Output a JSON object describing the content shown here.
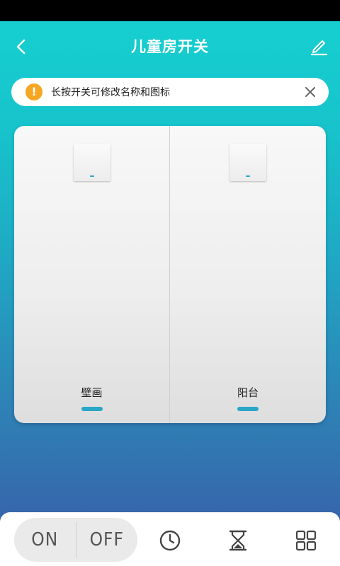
{
  "header": {
    "title": "儿童房开关"
  },
  "tip": {
    "text": "长按开关可修改名称和图标"
  },
  "switches": [
    {
      "label": "壁画"
    },
    {
      "label": "阳台"
    }
  ],
  "bottom": {
    "on_label": "ON",
    "off_label": "OFF"
  },
  "colors": {
    "accent": "#2aa7c6",
    "warning": "#f5a623",
    "gradient_top": "#16d1d0",
    "gradient_bottom": "#3a5aa8"
  },
  "icons": [
    "back-arrow-icon",
    "edit-pencil-icon",
    "warning-icon",
    "close-icon",
    "clock-icon",
    "hourglass-icon",
    "grid-icon"
  ]
}
